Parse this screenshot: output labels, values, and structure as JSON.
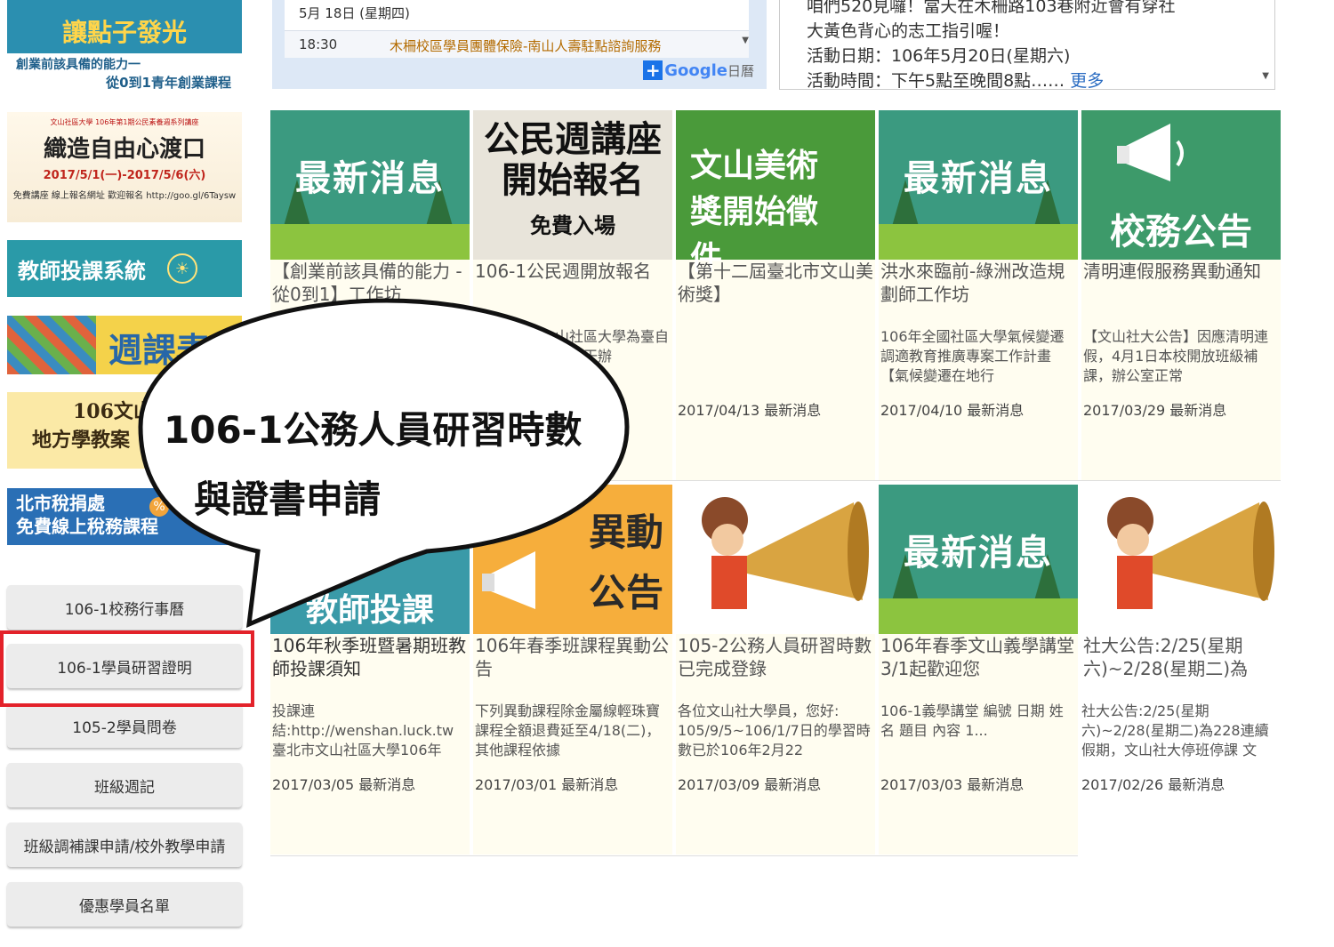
{
  "banners": {
    "b1": {
      "title": "讓點子發光",
      "sub1": "創業前該具備的能力一",
      "sub2": "從0到1青年創業課程"
    },
    "b2": {
      "small": "文山社區大學 106年第1期公民素養週系列講座",
      "title": "織造自由心渡口",
      "dates": "2017/5/1(一)-2017/5/6(六)",
      "note": "免費講座 線上報名網址 歡迎報名 http://goo.gl/6Taysw"
    },
    "b3": {
      "title": "教師投課系統"
    },
    "b4": {
      "title": "週課表"
    },
    "b5": {
      "line1": "106文山",
      "line2": "地方學教案"
    },
    "b6": {
      "line1": "北市稅捐處",
      "line2": "免費線上稅務課程",
      "pct": "%"
    }
  },
  "menu": [
    {
      "label": "106-1校務行事曆"
    },
    {
      "label": "106-1學員研習證明"
    },
    {
      "label": "105-2學員問卷"
    },
    {
      "label": "班級週記"
    },
    {
      "label": "班級調補課申請/校外教學申請"
    },
    {
      "label": "優惠學員名單"
    }
  ],
  "calendar": {
    "date": "5月 18日 (星期四)",
    "time": "18:30",
    "event": "木柵校區學員團體保險-南山人壽駐點諮詢服務",
    "google_label": "Google",
    "calendar_label": "日曆"
  },
  "announcement": {
    "line1": "咱們520見囉！當天在木柵路103巷附近會有穿社",
    "line2": "大黃色背心的志工指引喔！",
    "line3": "活動日期：106年5月20日(星期六)",
    "line4": "活動時間：下午5點至晚間8點……",
    "more": "更多"
  },
  "cards": [
    {
      "img_text": "最新消息",
      "title": "【創業前該具備的能力 - 從0到1】工作坊",
      "desc": "",
      "date": ""
    },
    {
      "img_text": "公民週講座開始報名",
      "img_small": "免費入場",
      "title": "106-1公民週開放報名",
      "desc": "山社區大學為臺自創校干辦",
      "date": ""
    },
    {
      "img_text": "文山美術獎開始徵件",
      "title": "【第十二屆臺北市文山美術獎】",
      "desc": "",
      "date": "2017/04/13 最新消息"
    },
    {
      "img_text": "最新消息",
      "title": "洪水來臨前-綠洲改造規劃師工作坊",
      "desc": "106年全國社區大學氣候變遷調適教育推廣專案工作計畫【氣候變遷在地行",
      "date": "2017/04/10 最新消息"
    },
    {
      "img_text": "校務公告",
      "title": "清明連假服務異動通知",
      "desc": "【文山社大公告】因應清明連假，4月1日本校開放班級補課，辦公室正常",
      "date": "2017/03/29 最新消息"
    },
    {
      "img_text": "教師投課",
      "title": "106年秋季班暨暑期班教師投課須知",
      "desc": "投課連結:http://wenshan.luck.tw 臺北市文山社區大學106年",
      "date": "2017/03/05 最新消息"
    },
    {
      "img_text": "異動公告",
      "title": "106年春季班課程異動公告",
      "desc": "下列異動課程除金屬線輕珠寶課程全額退費延至4/18(二)，其他課程依據",
      "date": "2017/03/01 最新消息"
    },
    {
      "img_text": "",
      "title": "105-2公務人員研習時數已完成登錄",
      "desc": "各位文山社大學員，您好: 105/9/5~106/1/7日的學習時數已於106年2月22",
      "date": "2017/03/09 最新消息"
    },
    {
      "img_text": "最新消息",
      "title": "106年春季文山義學講堂 3/1起歡迎您",
      "desc": "106-1義學講堂 編號 日期 姓名 題目 內容 1...",
      "date": "2017/03/03 最新消息"
    },
    {
      "img_text": "",
      "title": "社大公告:2/25(星期六)~2/28(星期二)為",
      "desc": "社大公告:2/25(星期六)~2/28(星期二)為228連續假期，文山社大停班停課 文",
      "date": "2017/02/26 最新消息"
    }
  ],
  "bubble": {
    "line1": "106-1公務人員研習時數",
    "line2": "與證書申請"
  },
  "colors": {
    "highlight": "#e3222a",
    "more_link": "#2a6cc2",
    "calendar_bg": "#dde8f6"
  }
}
